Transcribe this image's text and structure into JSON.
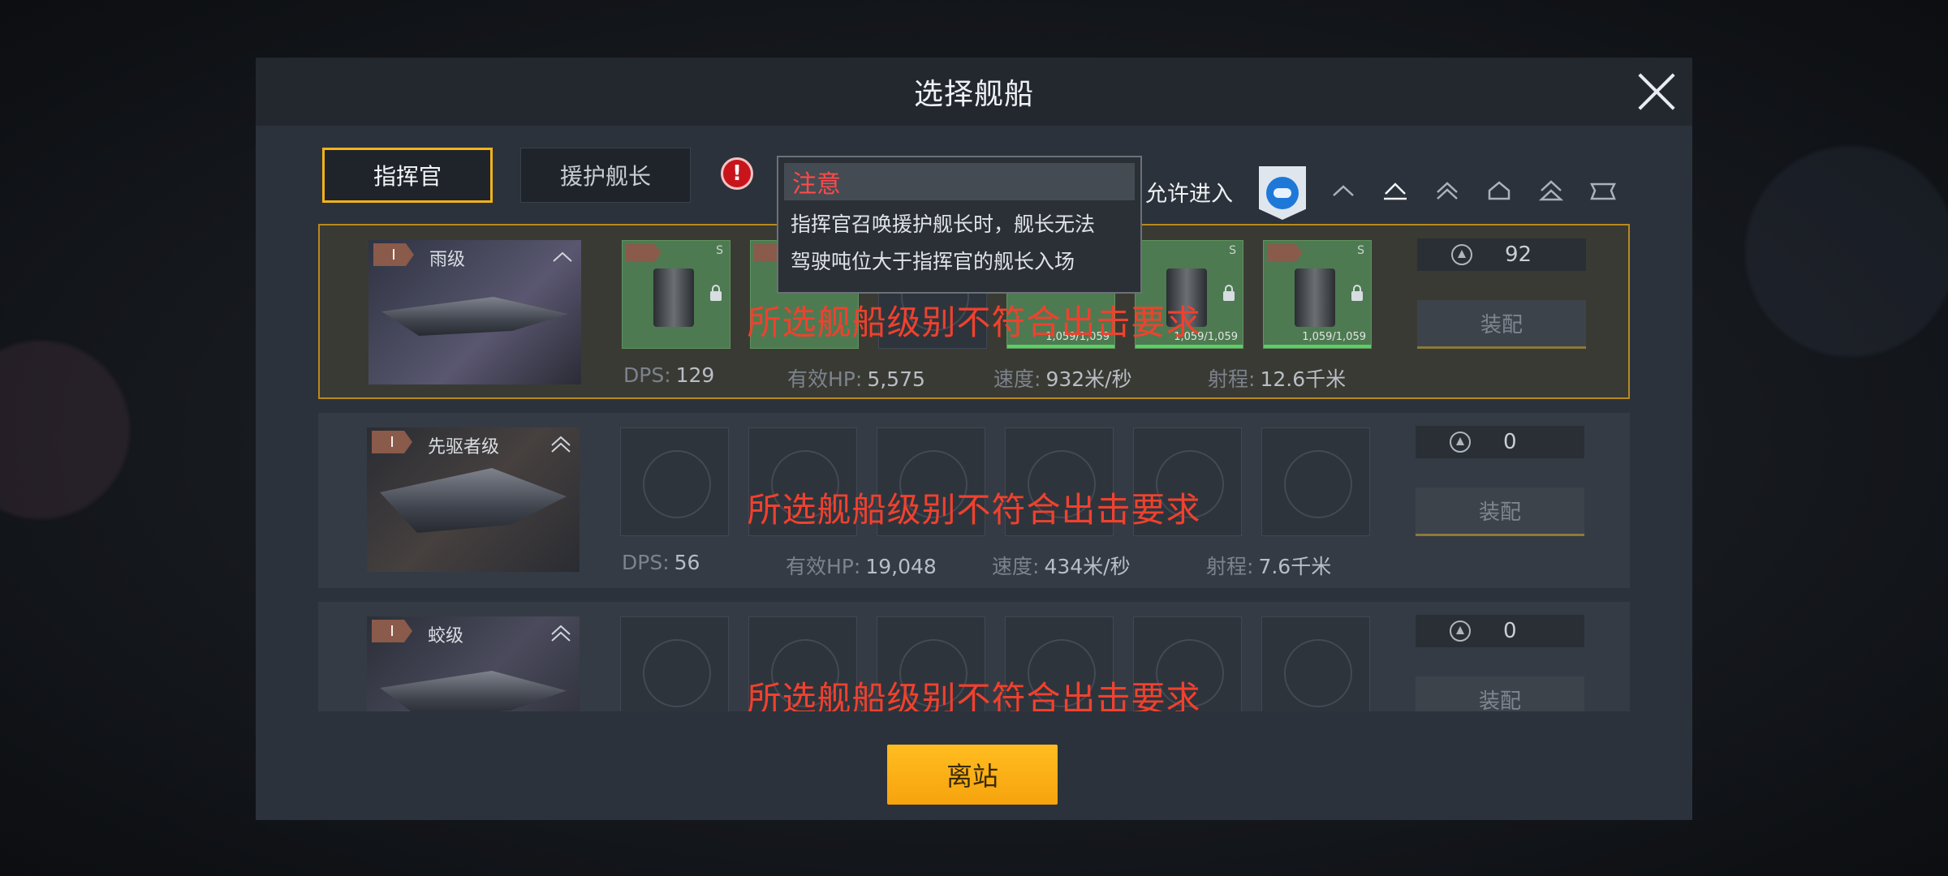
{
  "dialog": {
    "title": "选择舰船"
  },
  "tabs": [
    {
      "label": "指挥官",
      "active": true
    },
    {
      "label": "援护舰长",
      "active": false
    }
  ],
  "tooltip": {
    "title": "注意",
    "lines": [
      "指挥官召唤援护舰长时，舰长无法",
      "驾驶吨位大于指挥官的舰长入场"
    ]
  },
  "filter": {
    "allow_label": "允许进入",
    "rank_icons": [
      "frigate-rank-icon",
      "destroyer-rank-icon",
      "cruiser-rank-icon",
      "battlecruiser-rank-icon",
      "auxiliary-rank-icon",
      "carrier-rank-icon"
    ]
  },
  "ships": [
    {
      "tier": "I",
      "class": "雨级",
      "selected": true,
      "warning": "所选舰船级别不符合出击要求",
      "power": "92",
      "equip_label": "装配",
      "slots": [
        {
          "filled": true,
          "locked": true,
          "size": "S",
          "hp": ""
        },
        {
          "filled": true,
          "locked": false,
          "size": "",
          "hp": ""
        },
        {
          "filled": false,
          "locked": false,
          "size": "",
          "hp": ""
        },
        {
          "filled": true,
          "locked": false,
          "size": "",
          "hp": "1,059/1,059"
        },
        {
          "filled": true,
          "locked": true,
          "size": "S",
          "hp": "1,059/1,059"
        },
        {
          "filled": true,
          "locked": true,
          "size": "S",
          "hp": "1,059/1,059"
        }
      ],
      "stats": {
        "dps_label": "DPS:",
        "dps": "129",
        "hp_label": "有效HP:",
        "hp": "5,575",
        "speed_label": "速度:",
        "speed": "932米/秒",
        "range_label": "射程:",
        "range": "12.6千米"
      }
    },
    {
      "tier": "I",
      "class": "先驱者级",
      "selected": false,
      "warning": "所选舰船级别不符合出击要求",
      "power": "0",
      "equip_label": "装配",
      "slots": [
        {
          "filled": false
        },
        {
          "filled": false
        },
        {
          "filled": false
        },
        {
          "filled": false
        },
        {
          "filled": false
        },
        {
          "filled": false
        }
      ],
      "stats": {
        "dps_label": "DPS:",
        "dps": "56",
        "hp_label": "有效HP:",
        "hp": "19,048",
        "speed_label": "速度:",
        "speed": "434米/秒",
        "range_label": "射程:",
        "range": "7.6千米"
      }
    },
    {
      "tier": "I",
      "class": "蛟级",
      "selected": false,
      "warning": "所选舰船级别不符合出击要求",
      "power": "0",
      "equip_label": "装配",
      "slots": [
        {
          "filled": false
        },
        {
          "filled": false
        },
        {
          "filled": false
        },
        {
          "filled": false
        },
        {
          "filled": false
        },
        {
          "filled": false
        }
      ],
      "stats": {
        "dps_label": "",
        "dps": "",
        "hp_label": "",
        "hp": "",
        "speed_label": "",
        "speed": "",
        "range_label": "",
        "range": ""
      }
    }
  ],
  "footer": {
    "leave_label": "离站"
  },
  "colors": {
    "accent": "#f4b21b",
    "warning": "#f0412e",
    "slot_green": "#4e7a52"
  }
}
